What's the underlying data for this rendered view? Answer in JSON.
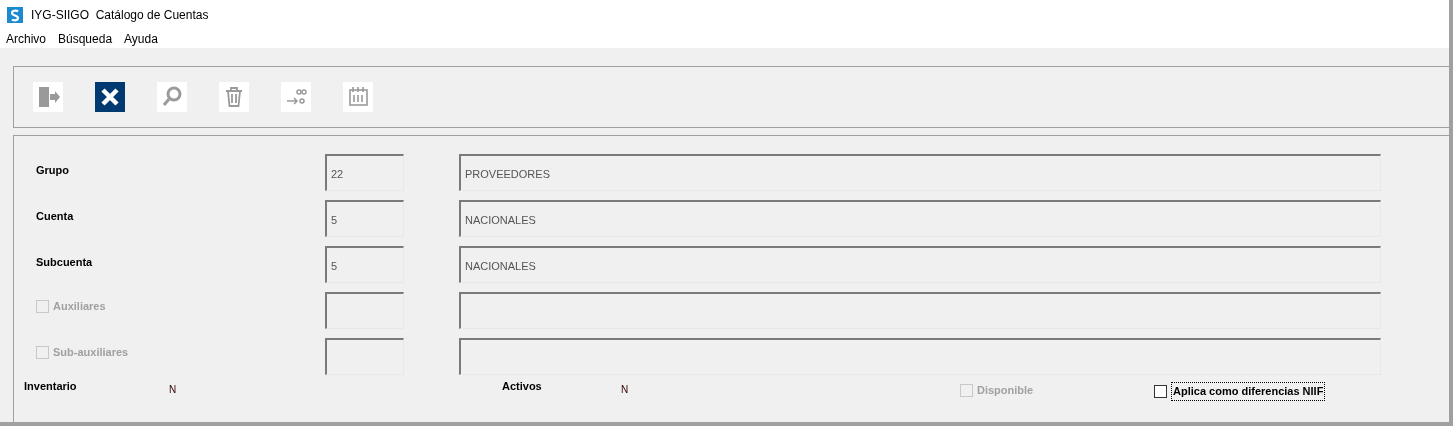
{
  "window": {
    "title": "IYG-SIIGO  Catálogo de Cuentas"
  },
  "menu": [
    "Archivo",
    "Búsqueda",
    "Ayuda"
  ],
  "toolbar": [
    {
      "kind": "exit",
      "selected": false
    },
    {
      "kind": "close",
      "selected": true
    },
    {
      "kind": "search",
      "selected": false
    },
    {
      "kind": "delete",
      "selected": false
    },
    {
      "kind": "decimals",
      "selected": false
    },
    {
      "kind": "calendar",
      "selected": false
    }
  ],
  "rows": [
    {
      "kind": "label",
      "label": "Grupo",
      "code": "22",
      "description": "PROVEEDORES"
    },
    {
      "kind": "label",
      "label": "Cuenta",
      "code": "5",
      "description": "NACIONALES"
    },
    {
      "kind": "label",
      "label": "Subcuenta",
      "code": "5",
      "description": "NACIONALES"
    },
    {
      "kind": "checkbox",
      "label": "Auxiliares",
      "checked": false,
      "disabled": true
    },
    {
      "kind": "checkbox",
      "label": "Sub-auxiliares",
      "checked": false,
      "disabled": true
    }
  ],
  "inventario": {
    "label": "Inventario",
    "value": "N"
  },
  "activos": {
    "label": "Activos",
    "value": "N"
  },
  "disponible": {
    "label": "Disponible",
    "checked": false,
    "disabled": true
  },
  "niif": {
    "label": "Aplica como diferencias NIIF",
    "checked": false,
    "disabled": false
  }
}
